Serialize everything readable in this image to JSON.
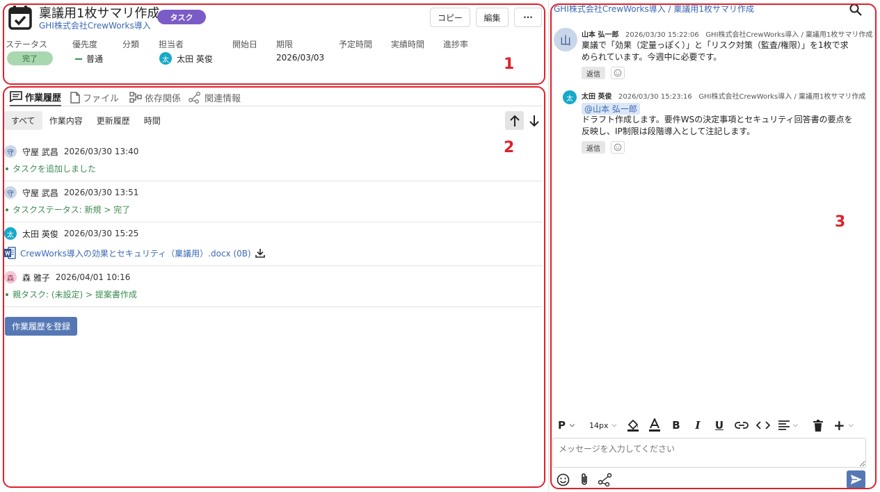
{
  "header": {
    "title": "稟議用1枚サマリ作成",
    "type_badge": "タスク",
    "project": "GHI株式会社CrewWorks導入",
    "buttons": {
      "copy": "コピー",
      "edit": "編集",
      "more": "···"
    },
    "fields": {
      "status_label": "ステータス",
      "status_value": "完了",
      "priority_label": "優先度",
      "priority_value": "普通",
      "category_label": "分類",
      "category_value": "",
      "assignee_label": "担当者",
      "assignee_value": "太田 英俊",
      "assignee_avatar": "太",
      "start_label": "開始日",
      "start_value": "",
      "due_label": "期限",
      "due_value": "2026/03/03",
      "planned_label": "予定時間",
      "planned_value": "",
      "actual_label": "実績時間",
      "actual_value": "",
      "progress_label": "進捗率",
      "progress_value": ""
    }
  },
  "tabs": {
    "history": "作業履歴",
    "files": "ファイル",
    "dependencies": "依存関係",
    "related": "関連情報"
  },
  "filters": {
    "all": "すべて",
    "work": "作業内容",
    "updates": "更新履歴",
    "time": "時間"
  },
  "history": [
    {
      "avatar": "守",
      "user": "守屋 武昌",
      "time": "2026/03/30 13:40",
      "text": "タスクを追加しました"
    },
    {
      "avatar": "守",
      "user": "守屋 武昌",
      "time": "2026/03/30 13:51",
      "text": "タスクステータス: 新規 > 完了"
    },
    {
      "avatar": "太",
      "user": "太田 英俊",
      "time": "2026/03/30 15:25",
      "file": "CrewWorks導入の効果とセキュリティ（稟議用）.docx (0B)"
    },
    {
      "avatar": "森",
      "user": "森 雅子",
      "time": "2026/04/01 10:16",
      "text": "親タスク: (未設定) > 提案書作成"
    }
  ],
  "register_button": "作業履歴を登録",
  "chat": {
    "breadcrumb": "GHI株式会社CrewWorks導入 / 稟議用1枚サマリ作成",
    "messages": [
      {
        "avatar": "山",
        "user": "山本 弘一郎",
        "time": "2026/03/30 15:22:06",
        "context": "GHI株式会社CrewWorks導入 / 稟議用1枚サマリ作成",
        "line1": "稟議で「効果（定量っぽく）」と「リスク対策（監査/権限）」を1枚で求",
        "line2": "められています。今週中に必要です。",
        "reply": "返信"
      },
      {
        "avatar": "太",
        "user": "太田 英俊",
        "time": "2026/03/30 15:23:16",
        "context": "GHI株式会社CrewWorks導入 / 稟議用1枚サマリ作成",
        "mention": "@山本 弘一郎",
        "line1": "ドラフト作成します。要件WSの決定事項とセキュリティ回答書の要点を",
        "line2": "反映し、IP制限は段階導入として注記します。",
        "reply": "返信"
      }
    ],
    "toolbar": {
      "paragraph": "P",
      "font_size": "14px"
    },
    "input_placeholder": "メッセージを入力してください"
  },
  "annotations": {
    "box1": "1",
    "box2": "2",
    "box3": "3"
  },
  "colors": {
    "accent": "#5578b5",
    "badge": "#7b5cc7",
    "status_done": "#a9d7b0",
    "history_text": "#3c8d51",
    "annotation": "#e0202a"
  }
}
